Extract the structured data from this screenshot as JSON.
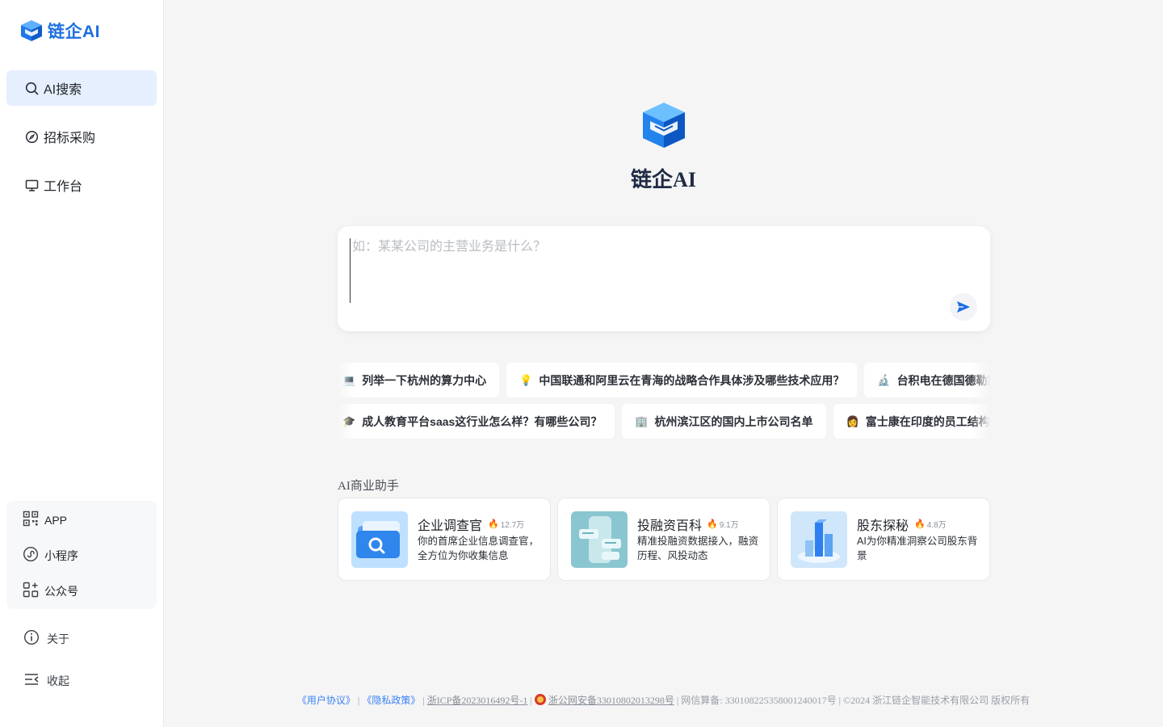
{
  "brand": {
    "name": "链企AI"
  },
  "sidebar": {
    "nav": [
      {
        "label": "AI搜索",
        "icon": "search-icon",
        "active": true
      },
      {
        "label": "招标采购",
        "icon": "compass-icon",
        "active": false
      },
      {
        "label": "工作台",
        "icon": "monitor-icon",
        "active": false
      }
    ],
    "apps": [
      {
        "label": "APP",
        "icon": "qrcode-icon"
      },
      {
        "label": "小程序",
        "icon": "miniprogram-icon"
      },
      {
        "label": "公众号",
        "icon": "apps-grid-icon"
      }
    ],
    "about": "关于",
    "collapse": "收起"
  },
  "hero": {
    "title": "链企AI"
  },
  "search": {
    "placeholder": "如：某某公司的主营业务是什么？"
  },
  "suggestions": {
    "row1": [
      {
        "emoji": "💻",
        "text": "列举一下杭州的算力中心"
      },
      {
        "emoji": "💡",
        "text": "中国联通和阿里云在青海的战略合作具体涉及哪些技术应用？"
      },
      {
        "emoji": "🔬",
        "text": "台积电在德国德勒斯登的工厂进展"
      }
    ],
    "row2": [
      {
        "emoji": "🎓",
        "text": "成人教育平台saas这行业怎么样？有哪些公司？"
      },
      {
        "emoji": "🏢",
        "text": "杭州滨江区的国内上市公司名单"
      },
      {
        "emoji": "👩",
        "text": "富士康在印度的员工结构"
      }
    ]
  },
  "assistants": {
    "title": "AI商业助手",
    "cards": [
      {
        "name": "企业调查官",
        "hot": "12.7万",
        "desc": "你的首席企业信息调查官，全方位为你收集信息"
      },
      {
        "name": "投融资百科",
        "hot": "9.1万",
        "desc": "精准投融资数据接入，融资历程、风投动态"
      },
      {
        "name": "股东探秘",
        "hot": "4.8万",
        "desc": "AI为你精准洞察公司股东背景"
      }
    ]
  },
  "footer": {
    "agreement": "《用户协议》",
    "privacy": "《隐私政策》",
    "icp": "浙ICP备2023016492号-1",
    "police": "浙公网安备33010802013298号",
    "algo": "网信算备: 330108225358001240017号",
    "copyright": "©2024 浙江链企智能技术有限公司 版权所有",
    "sep": "|"
  },
  "colors": {
    "accent": "#1d6fe0",
    "active_bg": "#e6effd",
    "page_bg": "#f5f5f5"
  }
}
